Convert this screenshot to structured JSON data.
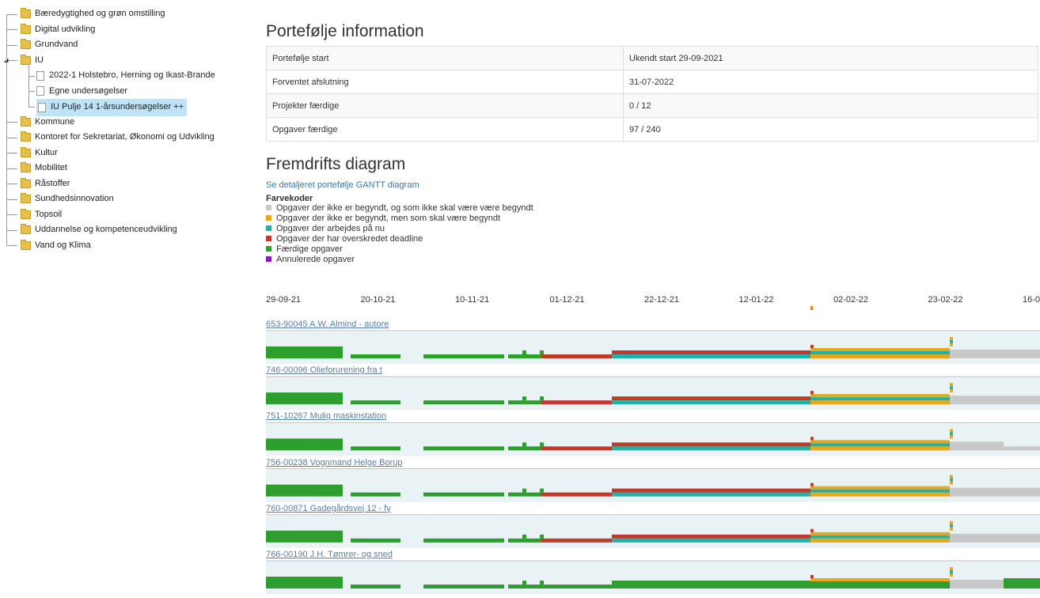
{
  "tree": {
    "items": [
      {
        "label": "Bæredygtighed og grøn omstilling",
        "level": 0,
        "type": "folder",
        "selected": false
      },
      {
        "label": "Digital udvikling",
        "level": 0,
        "type": "folder",
        "selected": false
      },
      {
        "label": "Grundvand",
        "level": 0,
        "type": "folder",
        "selected": false
      },
      {
        "label": "IU",
        "level": 0,
        "type": "folder",
        "expanded": true,
        "selected": false
      },
      {
        "label": "2022-1 Holstebro, Herning og Ikast-Brande",
        "level": 1,
        "type": "doc",
        "selected": false
      },
      {
        "label": "Egne undersøgelser",
        "level": 1,
        "type": "doc",
        "selected": false
      },
      {
        "label": "IU Pulje 14 1-årsundersøgelser ++",
        "level": 1,
        "type": "doc",
        "selected": true
      },
      {
        "label": "Kommune",
        "level": 0,
        "type": "folder",
        "selected": false
      },
      {
        "label": "Kontoret for Sekretariat, Økonomi og Udvikling",
        "level": 0,
        "type": "folder",
        "selected": false
      },
      {
        "label": "Kultur",
        "level": 0,
        "type": "folder",
        "selected": false
      },
      {
        "label": "Mobilitet",
        "level": 0,
        "type": "folder",
        "selected": false
      },
      {
        "label": "Råstoffer",
        "level": 0,
        "type": "folder",
        "selected": false
      },
      {
        "label": "Sundhedsinnovation",
        "level": 0,
        "type": "folder",
        "selected": false
      },
      {
        "label": "Topsoil",
        "level": 0,
        "type": "folder",
        "selected": false
      },
      {
        "label": "Uddannelse og kompetenceudvikling",
        "level": 0,
        "type": "folder",
        "selected": false
      },
      {
        "label": "Vand og Klima",
        "level": 0,
        "type": "folder",
        "selected": false
      }
    ]
  },
  "portfolio": {
    "title": "Portefølje information",
    "rows": [
      {
        "label": "Portefølje start",
        "value": "Ukendt start 29-09-2021"
      },
      {
        "label": "Forventet afslutning",
        "value": "31-07-2022"
      },
      {
        "label": "Projekter færdige",
        "value": "0 / 12"
      },
      {
        "label": "Opgaver færdige",
        "value": "97 / 240"
      }
    ]
  },
  "progress": {
    "title": "Fremdrifts diagram",
    "gantt_link": "Se detaljeret portefølje GANTT diagram",
    "legend_title": "Farvekoder",
    "legend": [
      {
        "label": "Opgaver der ikke er begyndt, og som ikke skal være være begyndt",
        "color": "#c8c8c8"
      },
      {
        "label": "Opgaver der ikke er begyndt, men som skal være begyndt",
        "color": "#e6a817"
      },
      {
        "label": "Opgaver der arbejdes på nu",
        "color": "#20b2aa"
      },
      {
        "label": "Opgaver der har overskredet deadline",
        "color": "#c0392b"
      },
      {
        "label": "Færdige opgaver",
        "color": "#2e9e2e"
      },
      {
        "label": "Annulerede opgaver",
        "color": "#8a1fb5"
      }
    ],
    "dates": [
      "29-09-21",
      "20-10-21",
      "10-11-21",
      "01-12-21",
      "22-12-21",
      "12-01-22",
      "02-02-22",
      "23-02-22",
      "16-0"
    ],
    "projects": [
      {
        "label": "653-90045 A.W. Almind - autore"
      },
      {
        "label": "746-00096 Olieforurening fra t"
      },
      {
        "label": "751-10267 Mulig maskinstation"
      },
      {
        "label": "756-00238 Vognmand Helge Borup"
      },
      {
        "label": "760-00871 Gadegårdsvej 12 - fy"
      },
      {
        "label": "766-00190 J.H. Tømrer- og sned"
      }
    ]
  },
  "colors": {
    "done": "#2e9e2e",
    "overdue": "#c0392b",
    "working": "#20b2aa",
    "late_start": "#e6a817",
    "not_started": "#c8c8c8",
    "cancelled": "#8a1fb5",
    "row_bg": "#e9f3f5",
    "link": "#5b7fa6",
    "today": "#f07b1e"
  },
  "icons": {
    "folder": "folder-icon",
    "document": "document-icon",
    "expander": "expand-triangle-icon"
  }
}
